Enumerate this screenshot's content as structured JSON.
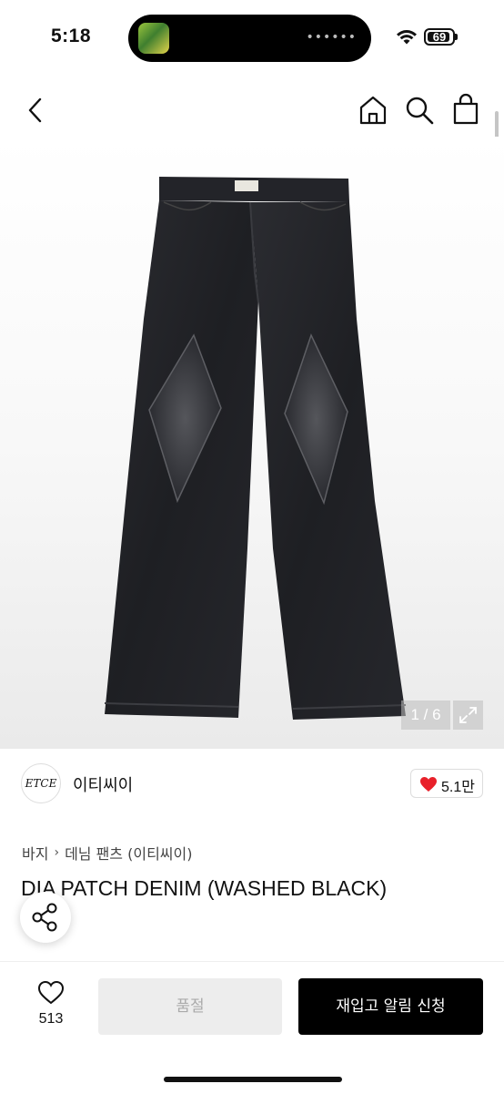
{
  "status_bar": {
    "time": "5:18",
    "battery": "69",
    "island_dots": "••••••"
  },
  "nav": {
    "back_icon": "chevron-left-icon",
    "home_icon": "home-icon",
    "search_icon": "search-icon",
    "cart_icon": "shopping-bag-icon"
  },
  "gallery": {
    "counter": "1 / 6",
    "expand_icon": "expand-icon",
    "image_subject": "denim-jeans"
  },
  "brand": {
    "logo_text": "ETCE",
    "name": "이티씨이",
    "like_count": "5.1만",
    "heart_color": "#e8202a"
  },
  "breadcrumb": {
    "category": "바지",
    "subcategory": "데님 팬츠 (이티씨이)"
  },
  "product": {
    "title": "DIA PATCH DENIM (WASHED BLACK)"
  },
  "bottom_bar": {
    "favorite_count": "513",
    "soldout_label": "품절",
    "restock_label": "재입고 알림 신청"
  }
}
